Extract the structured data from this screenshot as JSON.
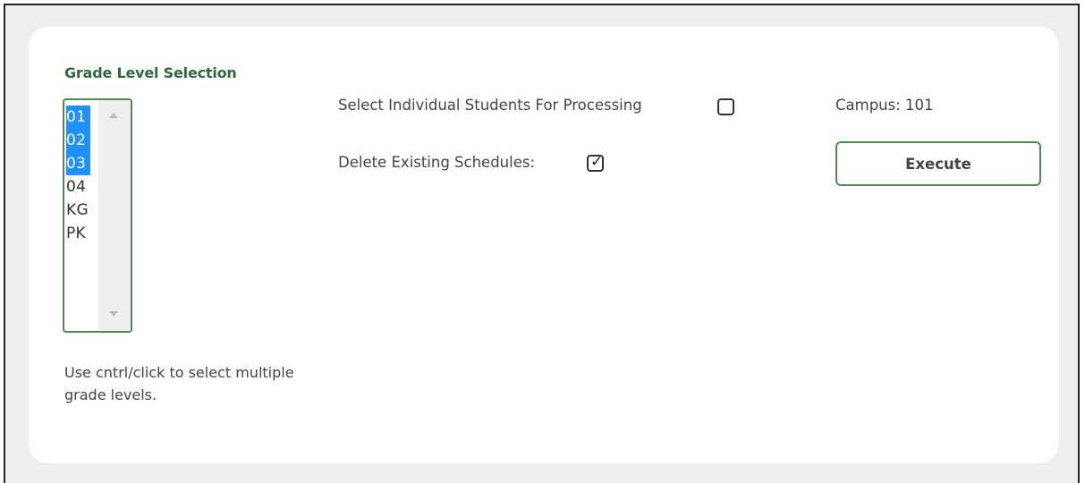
{
  "panel": {
    "title": "Grade Level Selection",
    "grade_levels": [
      {
        "label": "01",
        "selected": true
      },
      {
        "label": "02",
        "selected": true
      },
      {
        "label": "03",
        "selected": true
      },
      {
        "label": "04",
        "selected": false
      },
      {
        "label": "KG",
        "selected": false
      },
      {
        "label": "PK",
        "selected": false
      }
    ],
    "help_text": "Use cntrl/click to select multiple grade levels."
  },
  "options": {
    "select_individual_label": "Select Individual Students For Processing",
    "select_individual_checked": false,
    "delete_existing_label": "Delete Existing Schedules:",
    "delete_existing_checked": true,
    "check_glyph": "✓"
  },
  "campus": {
    "text": "Campus: 101"
  },
  "actions": {
    "execute_label": "Execute"
  },
  "colors": {
    "accent_green": "#2e6b3a",
    "border_green": "#4e8a55",
    "selection_blue": "#1e90ff",
    "frame_background": "#eeeeee"
  }
}
